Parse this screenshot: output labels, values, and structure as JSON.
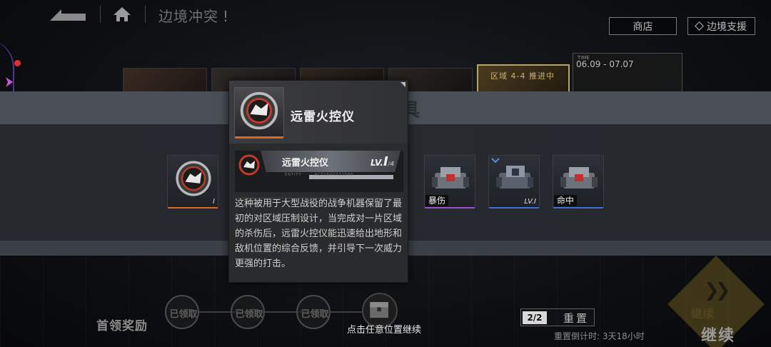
{
  "header": {
    "title": "边境冲突",
    "title_mark": "!",
    "shop_label": "商店",
    "support_label": "边境支援"
  },
  "stage_strip": {
    "zone_label": "区域 4-4 推进中",
    "date_header": "TIME",
    "date_range": "06.09 - 07.07"
  },
  "reward_banner": {
    "title": "获得道具",
    "items": [
      {
        "label": "",
        "level": "Ⅰ",
        "icon": "fire-control-chip-icon",
        "accent": "#e0661f"
      },
      {
        "label": "暴伤",
        "level": "",
        "icon": "mech-turret-icon",
        "accent": "#9a4fc4"
      },
      {
        "label": "",
        "level": "LV.Ⅰ",
        "icon": "mech-turret-icon",
        "accent": "#3f6fd0"
      },
      {
        "label": "命中",
        "level": "",
        "icon": "mech-turret-icon",
        "accent": "#3f6fd0"
      }
    ]
  },
  "tooltip": {
    "name": "远雷火控仪",
    "card_name": "远雷火控仪",
    "card_level": "LV.",
    "card_level_num": "Ⅰ",
    "card_level_max": "/4",
    "card_fine_print": "ENTITY · · · ACT1600732566",
    "description": "这种被用于大型战役的战争机器保留了最初的对区域压制设计，当完成对一片区域的杀伤后，远雷火控仪能迅速给出地形和敌机位置的综合反馈，并引导下一次威力更强的打击。"
  },
  "footer": {
    "first_reward_label": "首领奖励",
    "claimed_labels": [
      "已领取",
      "已领取",
      "已领取"
    ],
    "hint": "点击任意位置继续",
    "reset_count": "2/2",
    "reset_label": "重置",
    "reset_timer": "重置倒计时: 3天18小时",
    "continue_ghost": "继续",
    "continue_label": "继续"
  },
  "colors": {
    "accent_orange": "#e0661f",
    "accent_purple": "#9a4fc4",
    "accent_blue": "#3f6fd0",
    "alert_red": "#e03030",
    "gold": "#b7a26a"
  }
}
